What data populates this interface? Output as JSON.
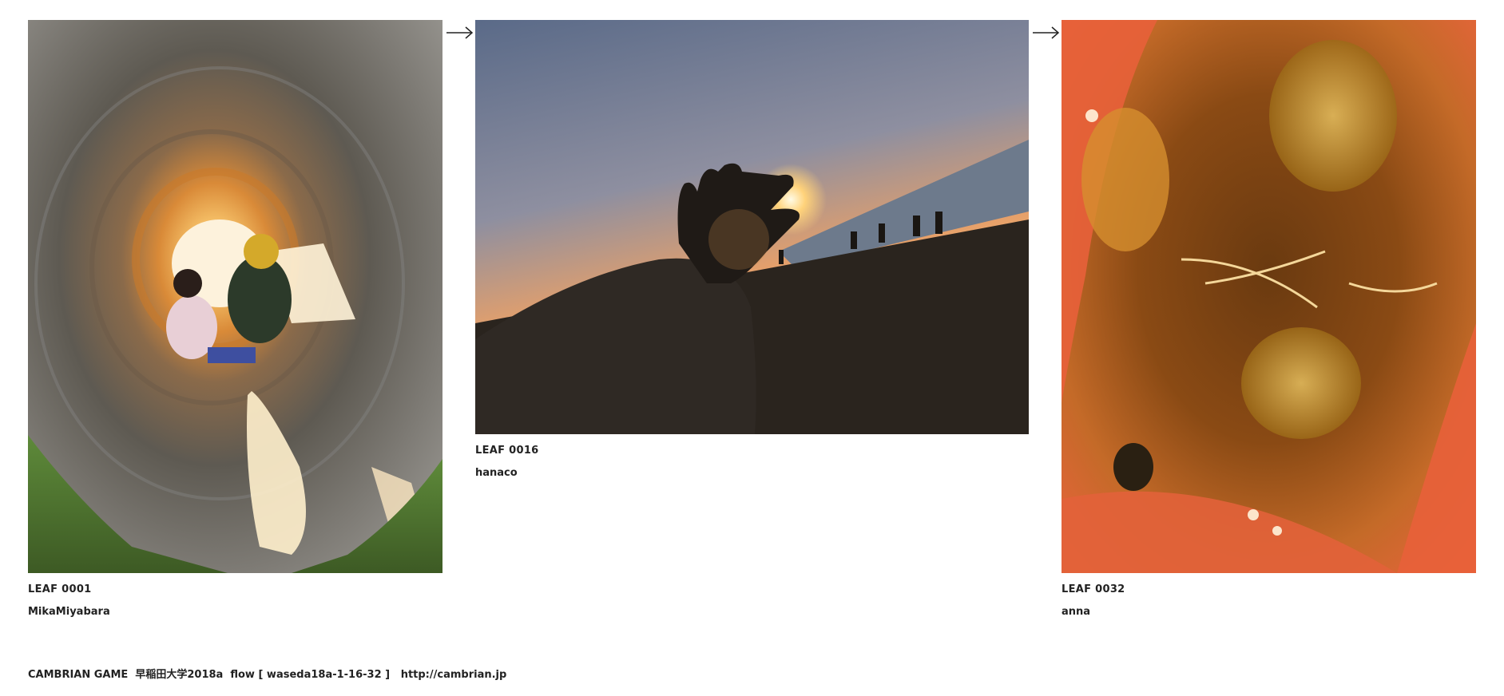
{
  "leaves": [
    {
      "id": "LEAF 0001",
      "author": "MikaMiyabara",
      "image": "children-in-concrete-pipe-tunnel"
    },
    {
      "id": "LEAF 0016",
      "author": "hanaco",
      "image": "hand-silhouette-against-sunset-beach"
    },
    {
      "id": "LEAF 0032",
      "author": "anna",
      "image": "macro-tomato-interior"
    }
  ],
  "footer": {
    "title": "CAMBRIAN GAME  早稲田大学2018a  flow [ waseda18a-1-16-32 ]",
    "url": "http://cambrian.jp"
  },
  "arrow_icon": "right-arrow-icon"
}
